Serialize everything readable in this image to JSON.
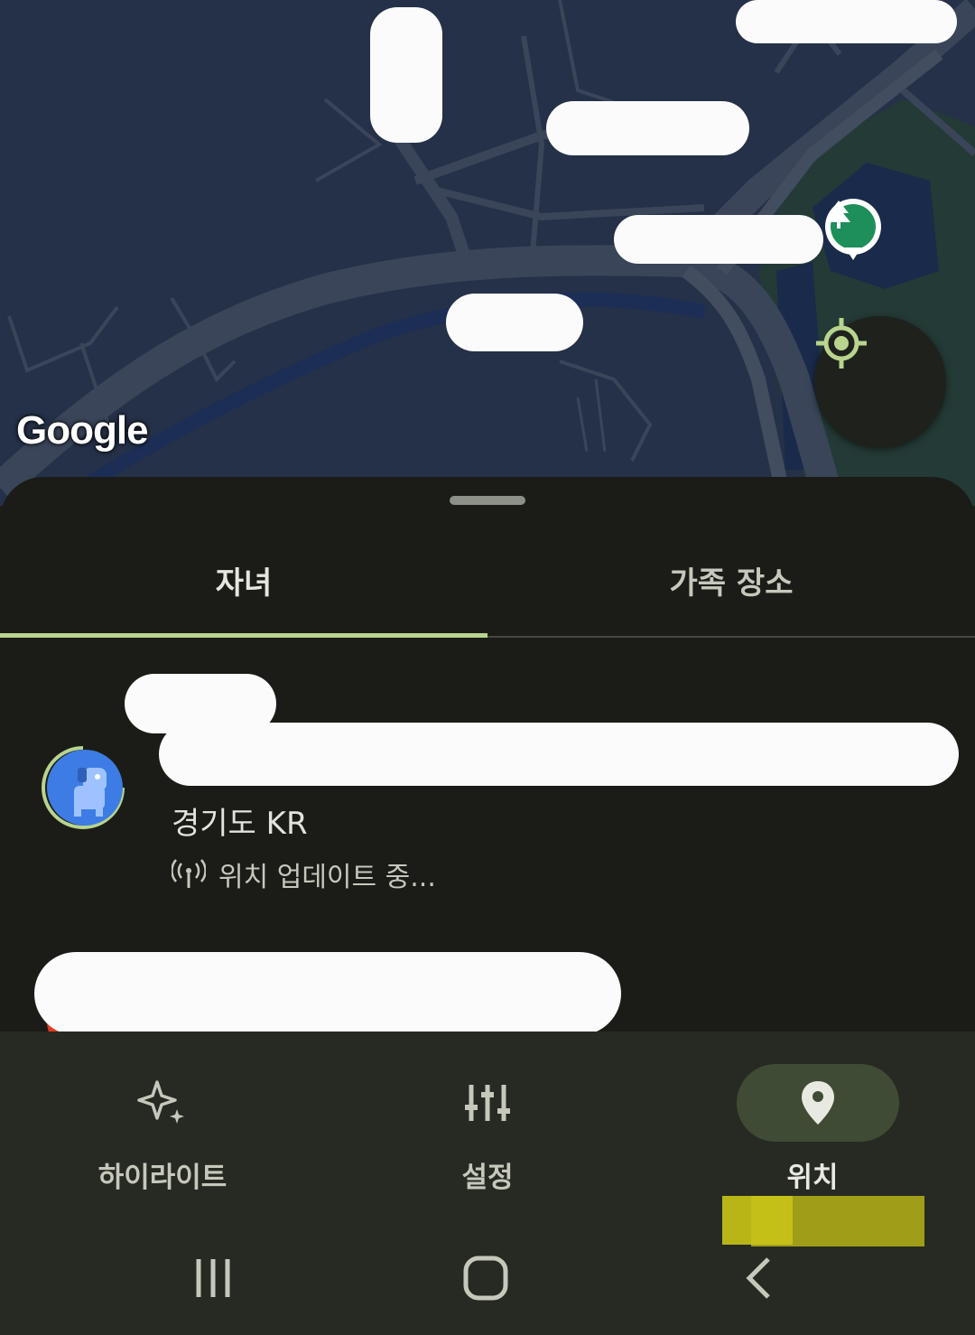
{
  "map": {
    "logo": "Google",
    "locate_button_icon": "my-location-icon",
    "park_marker_icon": "tree-icon"
  },
  "sheet": {
    "tabs": [
      {
        "label": "자녀",
        "active": true
      },
      {
        "label": "가족 장소",
        "active": false
      }
    ],
    "child": {
      "avatar_icon": "dog-avatar-icon",
      "region": "경기도 KR",
      "status_icon": "signal-icon",
      "status": "위치 업데이트 중..."
    }
  },
  "bottom_nav": {
    "items": [
      {
        "label": "하이라이트",
        "icon": "sparkle-icon",
        "active": false
      },
      {
        "label": "설정",
        "icon": "tune-icon",
        "active": false
      },
      {
        "label": "위치",
        "icon": "location-pin-icon",
        "active": true
      }
    ]
  },
  "system_bar": {
    "buttons": [
      "recents-icon",
      "home-icon",
      "back-icon"
    ]
  },
  "colors": {
    "accent": "#b8d48e",
    "map_bg": "#253148",
    "sheet_bg": "#1b1c17",
    "nav_bg": "#272a22",
    "park_green": "#1e8e5a"
  }
}
